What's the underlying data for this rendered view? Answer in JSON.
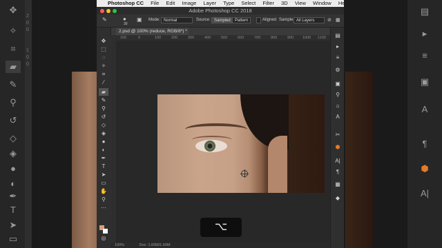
{
  "menubar": {
    "items": [
      "Photoshop CC",
      "File",
      "Edit",
      "Image",
      "Layer",
      "Type",
      "Select",
      "Filter",
      "3D",
      "View",
      "Window",
      "Help"
    ]
  },
  "window": {
    "title": "Adobe Photoshop CC 2018"
  },
  "options": {
    "mode_label": "Mode:",
    "mode_value": "Normal",
    "source_label": "Source:",
    "source_sampled": "Sampled",
    "source_pattern": "Pattern",
    "aligned_label": "Aligned",
    "sample_label": "Sample:",
    "sample_value": "All Layers",
    "brush_size": "30"
  },
  "document": {
    "tab_title": "2.psd @ 100% (reduce, RGB/8*) *",
    "ruler_ticks": [
      "100",
      "0",
      "100",
      "200",
      "300",
      "400",
      "500",
      "600",
      "700",
      "800",
      "900",
      "1000",
      "1100"
    ],
    "zoom": "100%",
    "doc_info": "Doc: 1.60M/1.60M"
  },
  "bg_ruler_ticks": [
    "2",
    "0",
    "0",
    "1",
    "0",
    "0"
  ],
  "keycap": {
    "symbol": "⌥"
  },
  "colors": {
    "foreground": "#d9a07a",
    "background": "#ffffff",
    "accent": "#e07b2a"
  }
}
